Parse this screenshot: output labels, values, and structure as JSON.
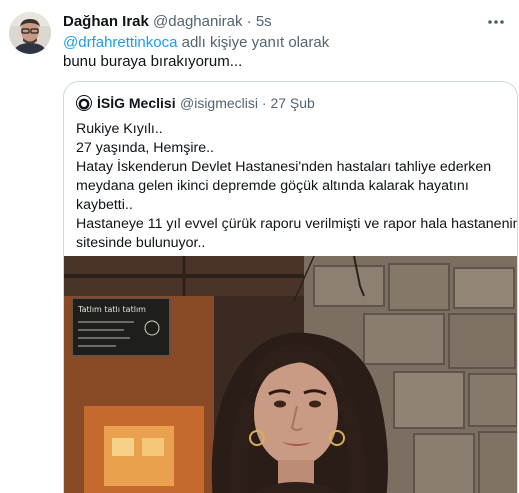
{
  "tweet": {
    "author_name": "Dağhan Irak",
    "author_handle": "@daghanirak",
    "separator": "·",
    "time": "5s",
    "reply_mention": "@drfahrettinkoca",
    "reply_suffix": " adlı kişiye yanıt olarak",
    "text": "bunu buraya bırakıyorum...",
    "more_icon": "more-horizontal-icon"
  },
  "quote": {
    "author_name": "İSİG Meclisi",
    "author_handle": "@isigmeclisi",
    "separator": "·",
    "date": "27 Şub",
    "lines": [
      "Rukiye Kıyılı..",
      "27 yaşında, Hemşire..",
      "Hatay İskenderun Devlet Hastanesi'nden hastaları tahliye ederken",
      "meydana gelen ikinci depremde göçük altında kalarak hayatını",
      "kaybetti..",
      "Hastaneye 11 yıl evvel çürük raporu verilmişti ve rapor hala hastanenin",
      "sitesinde bulunuyor.."
    ],
    "chalkboard_text": "Tatlım tatlı tatlım"
  },
  "colors": {
    "text_primary": "#0f1419",
    "text_secondary": "#536471",
    "link": "#1d9bf0",
    "border": "#cfd9de"
  }
}
